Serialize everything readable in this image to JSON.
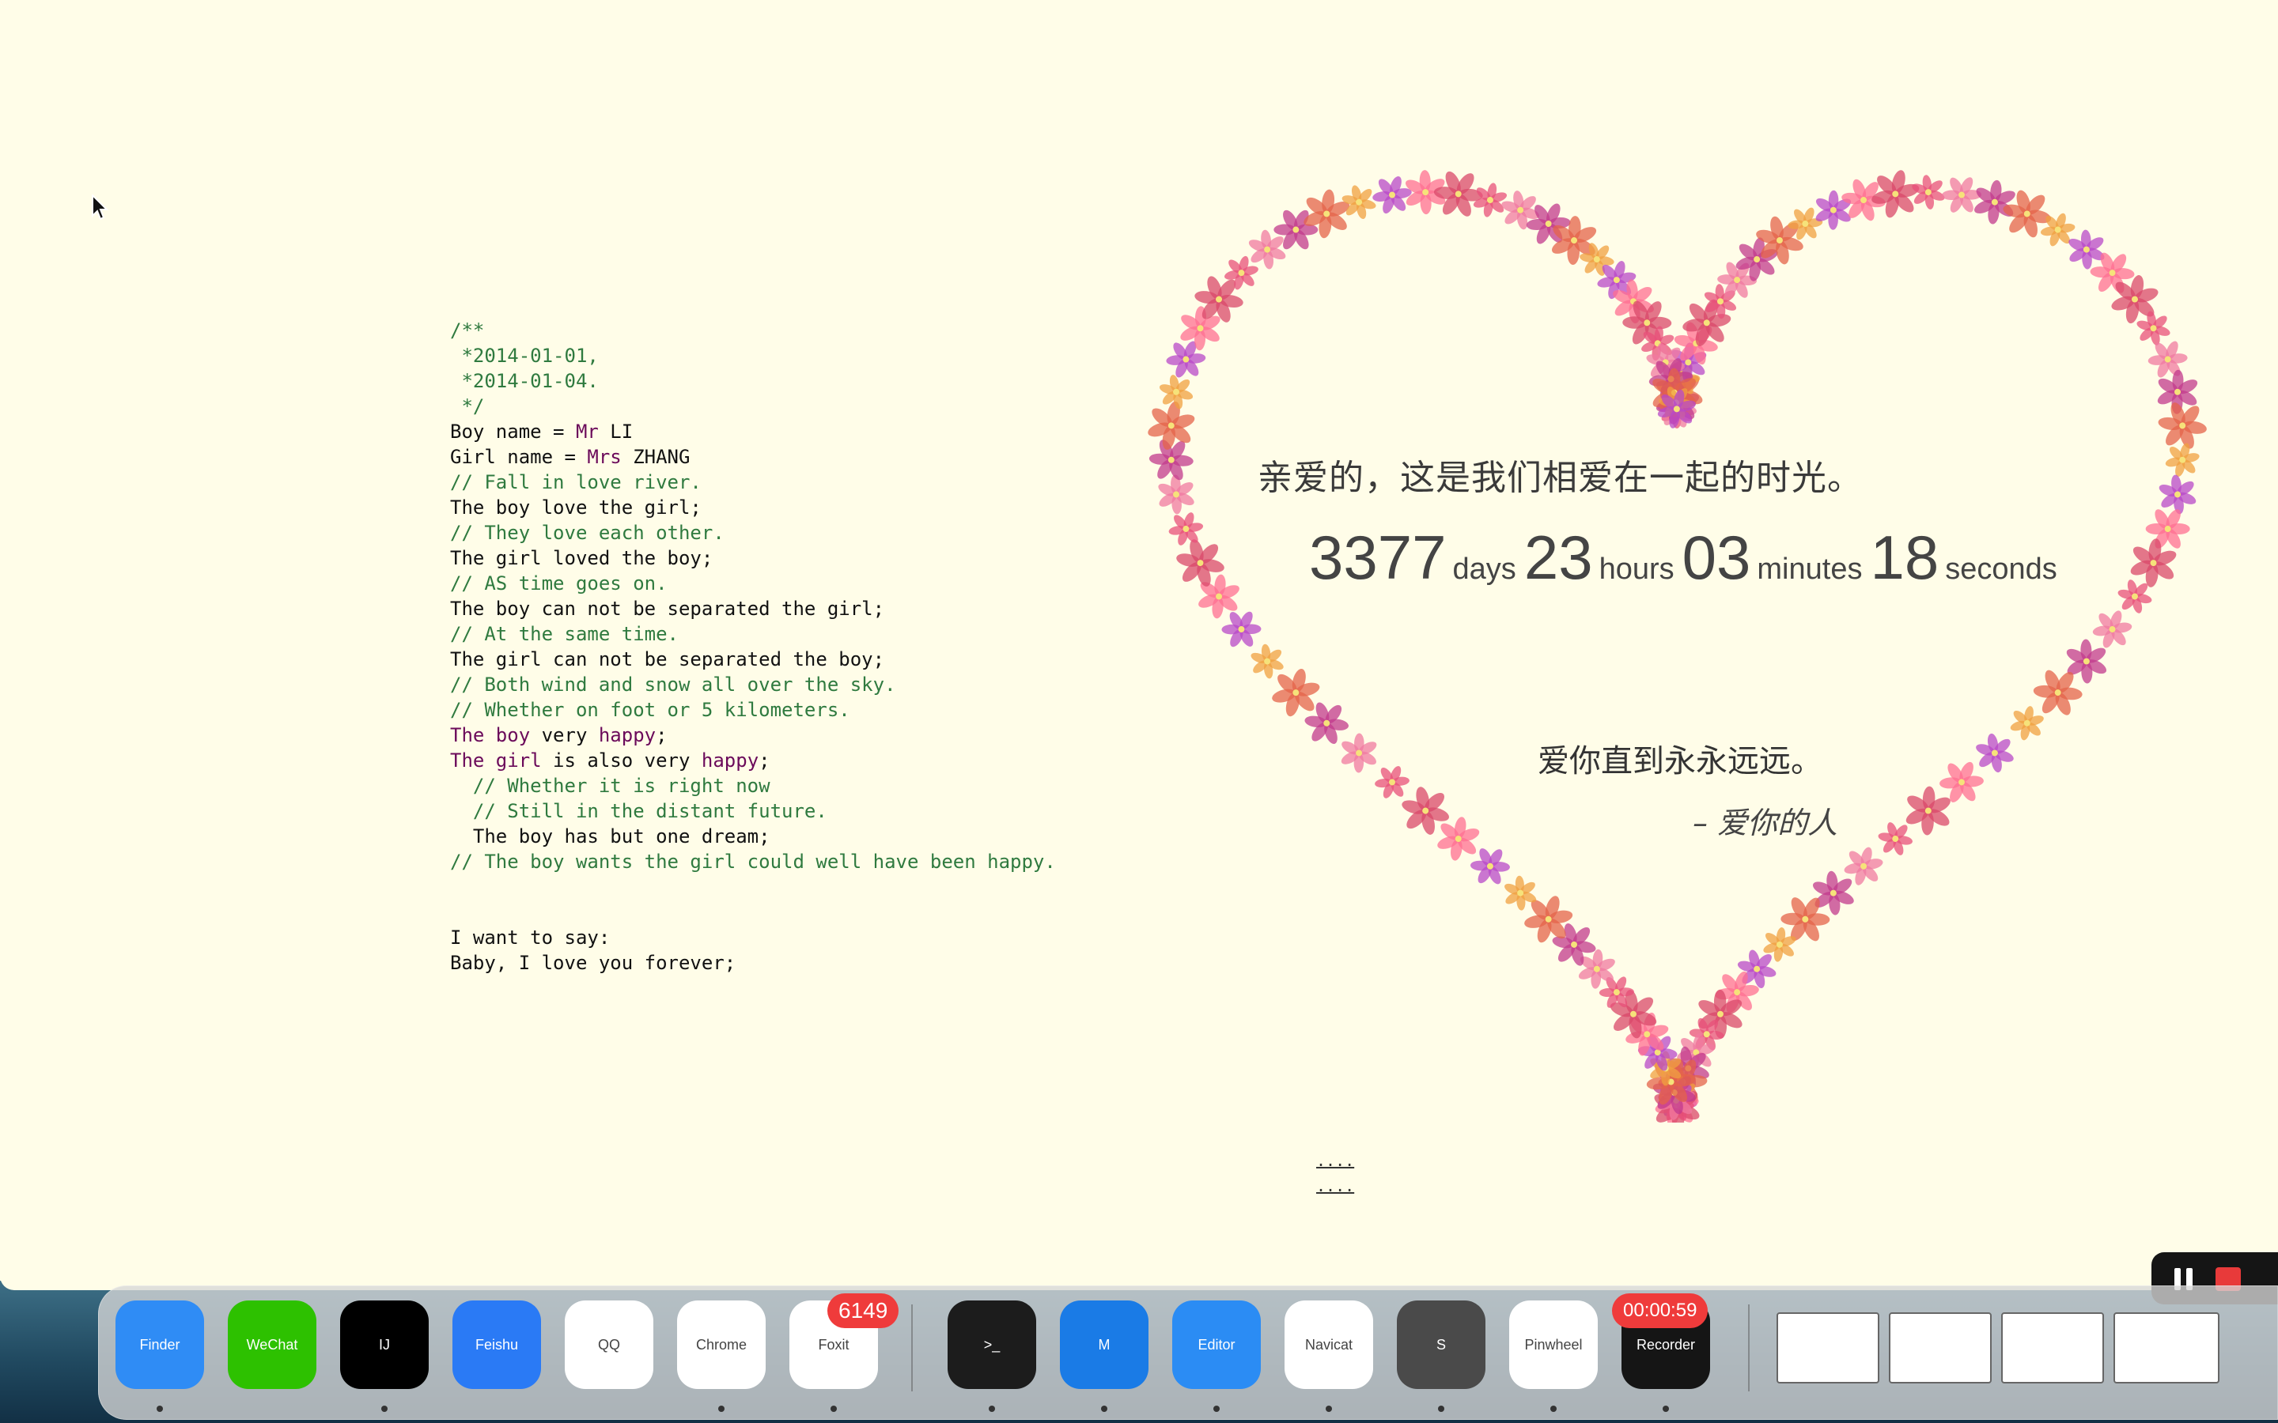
{
  "code": {
    "lines": [
      [
        {
          "t": "/**",
          "s": "comment"
        }
      ],
      [
        {
          "t": " *2014-01-01,",
          "s": "comment"
        }
      ],
      [
        {
          "t": " *2014-01-04.",
          "s": "comment"
        }
      ],
      [
        {
          "t": " */",
          "s": "comment"
        }
      ],
      [
        {
          "t": "Boy name = ",
          "s": "plain"
        },
        {
          "t": "Mr",
          "s": "kw"
        },
        {
          "t": " LI",
          "s": "plain"
        }
      ],
      [
        {
          "t": "Girl name = ",
          "s": "plain"
        },
        {
          "t": "Mrs",
          "s": "kw"
        },
        {
          "t": " ZHANG",
          "s": "plain"
        }
      ],
      [
        {
          "t": "// Fall in love river.",
          "s": "comment"
        }
      ],
      [
        {
          "t": "The boy love the girl;",
          "s": "plain"
        }
      ],
      [
        {
          "t": "// They love each other.",
          "s": "comment"
        }
      ],
      [
        {
          "t": "The girl loved the boy;",
          "s": "plain"
        }
      ],
      [
        {
          "t": "// AS time goes on.",
          "s": "comment"
        }
      ],
      [
        {
          "t": "The boy can not be separated the girl;",
          "s": "plain"
        }
      ],
      [
        {
          "t": "// At the same time.",
          "s": "comment"
        }
      ],
      [
        {
          "t": "The girl can not be separated the boy;",
          "s": "plain"
        }
      ],
      [
        {
          "t": "// Both wind and snow all over the sky.",
          "s": "comment"
        }
      ],
      [
        {
          "t": "// Whether on foot or 5 kilometers.",
          "s": "comment"
        }
      ],
      [
        {
          "t": "The boy",
          "s": "kw"
        },
        {
          "t": " very ",
          "s": "plain"
        },
        {
          "t": "happy",
          "s": "kw"
        },
        {
          "t": ";",
          "s": "plain"
        }
      ],
      [
        {
          "t": "The girl",
          "s": "kw"
        },
        {
          "t": " is also very ",
          "s": "plain"
        },
        {
          "t": "happy",
          "s": "kw"
        },
        {
          "t": ";",
          "s": "plain"
        }
      ],
      [
        {
          "t": "  // Whether it is right now",
          "s": "comment"
        }
      ],
      [
        {
          "t": "  // Still in the distant future.",
          "s": "comment"
        }
      ],
      [
        {
          "t": "  The boy has but one dream;",
          "s": "plain"
        }
      ],
      [
        {
          "t": "// The boy wants the girl could well have been happy.",
          "s": "comment"
        }
      ]
    ],
    "closing": [
      "I want to say:",
      "Baby, I love you forever;"
    ]
  },
  "heart": {
    "title": "亲爱的，这是我们相爱在一起的时光。",
    "timer": {
      "days": "3377",
      "days_label": "days",
      "hours": "23",
      "hours_label": "hours",
      "minutes": "03",
      "minutes_label": "minutes",
      "seconds": "18",
      "seconds_label": "seconds"
    },
    "forever": "爱你直到永永远远。",
    "signature": "– 爱你的人",
    "flower_colors": [
      "#e8507a",
      "#f07aa0",
      "#c23a8c",
      "#e4634a",
      "#f0a040",
      "#b848c8",
      "#ff6f91",
      "#d9486a"
    ]
  },
  "dots": [
    "....",
    "...."
  ],
  "dock": {
    "apps": [
      {
        "name": "finder-icon",
        "label": "Finder",
        "color": "#2f8cf5",
        "running": true
      },
      {
        "name": "wechat-icon",
        "label": "WeChat",
        "color": "#2dc100",
        "running": false
      },
      {
        "name": "intellij-icon",
        "label": "IJ",
        "color": "#000000",
        "running": true
      },
      {
        "name": "feishu-icon",
        "label": "Feishu",
        "color": "#2a7af5",
        "running": false
      },
      {
        "name": "qq-icon",
        "label": "QQ",
        "color": "#ffffff",
        "running": false
      },
      {
        "name": "chrome-icon",
        "label": "Chrome",
        "color": "#ffffff",
        "running": true
      },
      {
        "name": "foxit-icon",
        "label": "Foxit",
        "color": "#ffffff",
        "running": true
      }
    ],
    "apps2": [
      {
        "name": "terminal-icon",
        "label": ">_",
        "color": "#1c1c1c",
        "running": true
      },
      {
        "name": "maxthon-icon",
        "label": "M",
        "color": "#1a7be6",
        "running": true
      },
      {
        "name": "notes-editor-icon",
        "label": "Editor",
        "color": "#2b8cf4",
        "running": true
      },
      {
        "name": "navicat-icon",
        "label": "Navicat",
        "color": "#ffffff",
        "running": true
      },
      {
        "name": "sublime-icon",
        "label": "S",
        "color": "#4a4a4a",
        "running": true
      },
      {
        "name": "pinwheel-icon",
        "label": "Pinwheel",
        "color": "#ffffff",
        "running": true
      },
      {
        "name": "screen-recorder-icon",
        "label": "Recorder",
        "color": "#151515",
        "running": true
      }
    ],
    "badge_count": "6149",
    "recording_time": "00:00:59"
  }
}
